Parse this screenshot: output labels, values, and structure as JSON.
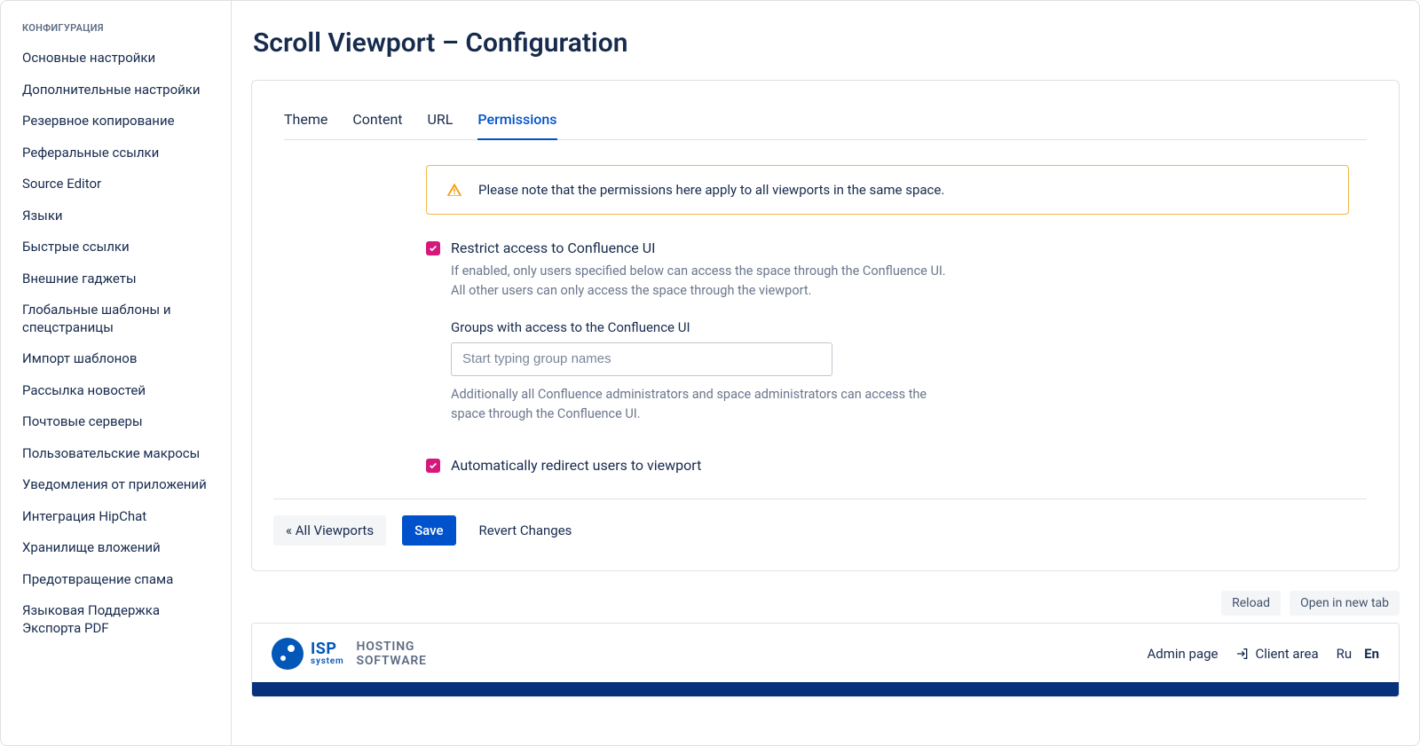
{
  "sidebar": {
    "section_title": "КОНФИГУРАЦИЯ",
    "items": [
      "Основные настройки",
      "Дополнительные настройки",
      "Резервное копирование",
      "Реферальные ссылки",
      "Source Editor",
      "Языки",
      "Быстрые ссылки",
      "Внешние гаджеты",
      "Глобальные шаблоны и спецстраницы",
      "Импорт шаблонов",
      "Рассылка новостей",
      "Почтовые серверы",
      "Пользовательские макросы",
      "Уведомления от приложений",
      "Интеграция HipChat",
      "Хранилище вложений",
      "Предотвращение спама",
      "Языковая Поддержка Экспорта PDF"
    ]
  },
  "page_title": "Scroll Viewport – Configuration",
  "tabs": {
    "items": [
      "Theme",
      "Content",
      "URL",
      "Permissions"
    ],
    "active_index": 3
  },
  "notice": "Please note that the permissions here apply to all viewports in the same space.",
  "restrict": {
    "label": "Restrict access to Confluence UI",
    "desc_line1": "If enabled, only users specified below can access the space through the Confluence UI.",
    "desc_line2": "All other users can only access the space through the viewport."
  },
  "groups_field": {
    "label": "Groups with access to the Confluence UI",
    "placeholder": "Start typing group names",
    "help": "Additionally all Confluence administrators and space administrators can access the space through the Confluence UI."
  },
  "auto_redirect": {
    "label": "Automatically redirect users to viewport"
  },
  "actions": {
    "all_viewports": "« All Viewports",
    "save": "Save",
    "revert": "Revert Changes"
  },
  "screenshot_toolbar": {
    "reload": "Reload",
    "open_tab": "Open in new tab"
  },
  "embed": {
    "isp_top": "ISP",
    "isp_bottom": "system",
    "hosting_top": "HOSTING",
    "hosting_bottom": "SOFTWARE",
    "admin": "Admin page",
    "client": "Client area",
    "lang_ru": "Ru",
    "lang_en": "En"
  }
}
